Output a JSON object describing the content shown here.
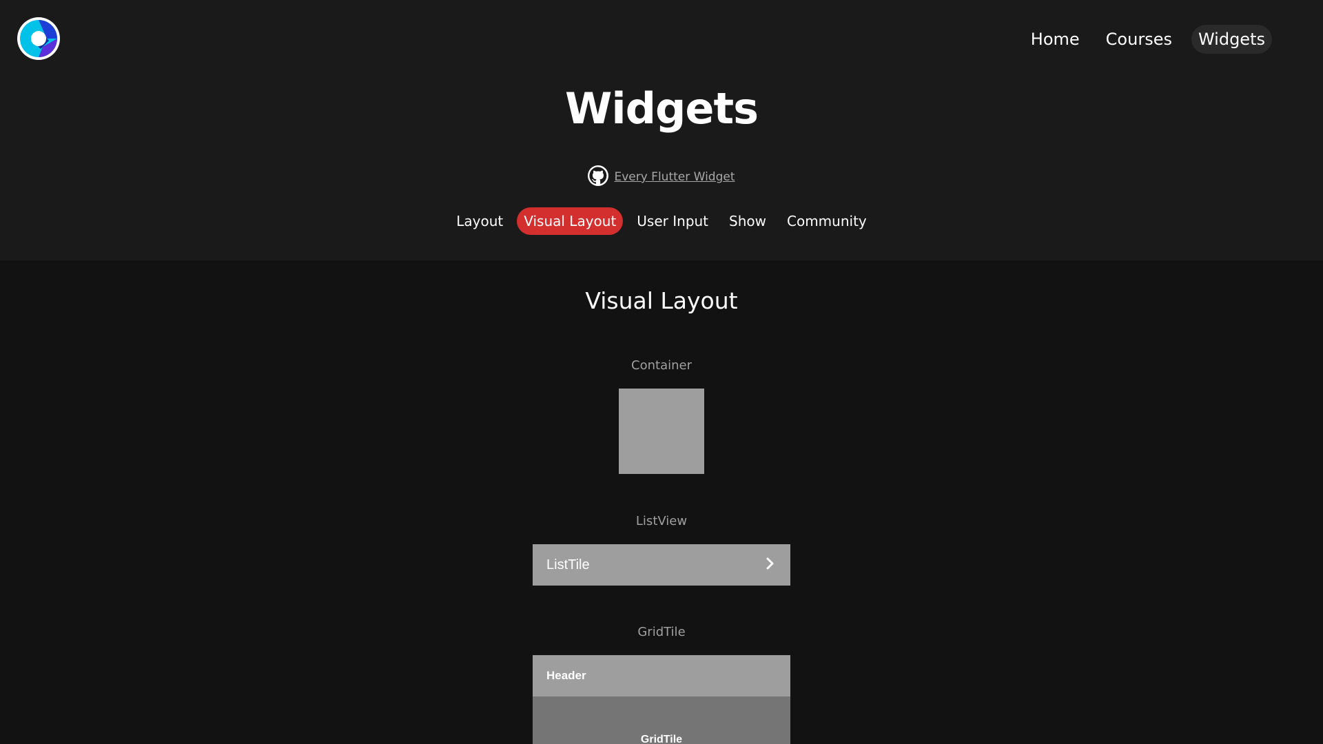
{
  "nav": {
    "logo_icon": "flutter-logo-icon",
    "items": [
      {
        "label": "Home",
        "active": false
      },
      {
        "label": "Courses",
        "active": false
      },
      {
        "label": "Widgets",
        "active": true
      }
    ]
  },
  "header": {
    "title": "Widgets",
    "repo_icon": "github-icon",
    "repo_link": "Every Flutter Widget"
  },
  "categories": [
    {
      "label": "Layout",
      "active": false
    },
    {
      "label": "Visual Layout",
      "active": true
    },
    {
      "label": "User Input",
      "active": false
    },
    {
      "label": "Show",
      "active": false
    },
    {
      "label": "Community",
      "active": false
    }
  ],
  "section": {
    "title": "Visual Layout",
    "demos": {
      "container": {
        "label": "Container"
      },
      "listview": {
        "label": "ListView",
        "tile_title": "ListTile",
        "trailing_icon": "chevron-right-icon"
      },
      "gridtile": {
        "label": "GridTile",
        "header": "Header",
        "body": "GridTile"
      }
    }
  },
  "colors": {
    "page_bg": "#121212",
    "header_bg": "#1a1a1a",
    "accent": "#d32f2f",
    "tile_gray": "#9e9e9e",
    "tile_dark_gray": "#757575",
    "label_gray": "#a0a0a0"
  }
}
